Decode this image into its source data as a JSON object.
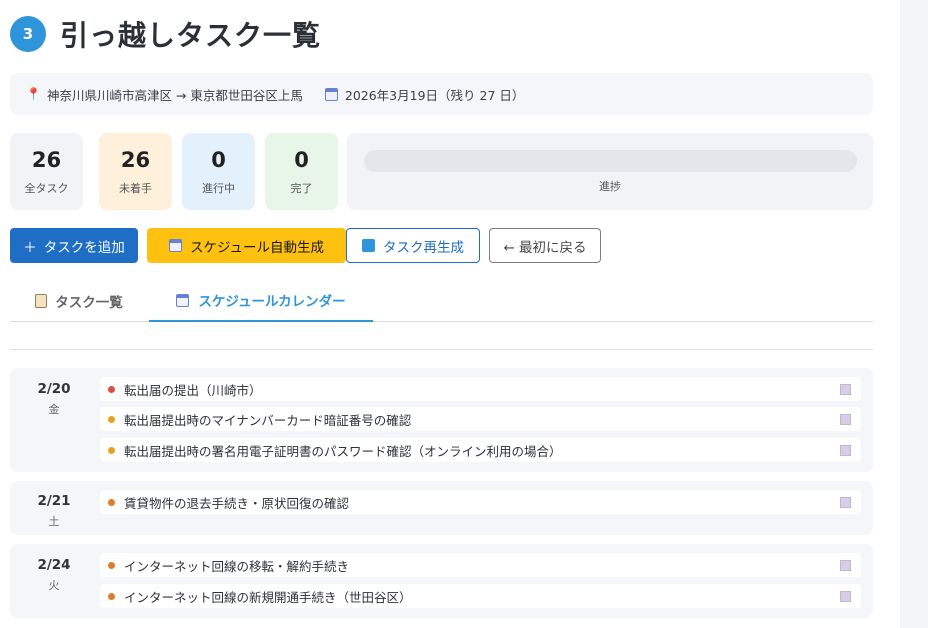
{
  "header": {
    "step": "3",
    "title": "引っ越しタスク一覧"
  },
  "info": {
    "route": "神奈川県川崎市高津区 → 東京都世田谷区上馬",
    "date": "2026年3月19日（残り 27 日）"
  },
  "stats": [
    {
      "value": "26",
      "label": "全タスク",
      "bg": "#f1f3f6"
    },
    {
      "value": "26",
      "label": "未着手",
      "bg": "#fff0dc"
    },
    {
      "value": "0",
      "label": "進行中",
      "bg": "#e3f1fc"
    },
    {
      "value": "0",
      "label": "完了",
      "bg": "#e8f5e9"
    }
  ],
  "progress": {
    "label": "進捗",
    "percent": 0
  },
  "actions": {
    "add": "タスクを追加",
    "auto_schedule": "スケジュール自動生成",
    "regenerate": "タスク再生成",
    "back": "← 最初に戻る"
  },
  "tabs": {
    "list": "タスク一覧",
    "calendar": "スケジュールカレンダー",
    "active": "calendar"
  },
  "colors": {
    "accent": "#2f95db",
    "primary": "#1e6ec6",
    "warning": "#fec10f",
    "high": "#e04b3f",
    "medium": "#e9a21b",
    "low": "#e07b2c"
  },
  "schedule": [
    {
      "date": "2/20",
      "weekday": "金",
      "tasks": [
        {
          "title": "転出届の提出（川崎市）",
          "color": "#e04b3f"
        },
        {
          "title": "転出届提出時のマイナンバーカード暗証番号の確認",
          "color": "#e9a21b"
        },
        {
          "title": "転出届提出時の署名用電子証明書のパスワード確認（オンライン利用の場合）",
          "color": "#e9a21b"
        }
      ]
    },
    {
      "date": "2/21",
      "weekday": "土",
      "tasks": [
        {
          "title": "賃貸物件の退去手続き・原状回復の確認",
          "color": "#e07b2c"
        }
      ]
    },
    {
      "date": "2/24",
      "weekday": "火",
      "tasks": [
        {
          "title": "インターネット回線の移転・解約手続き",
          "color": "#e07b2c"
        },
        {
          "title": "インターネット回線の新規開通手続き（世田谷区）",
          "color": "#e07b2c"
        }
      ]
    }
  ]
}
